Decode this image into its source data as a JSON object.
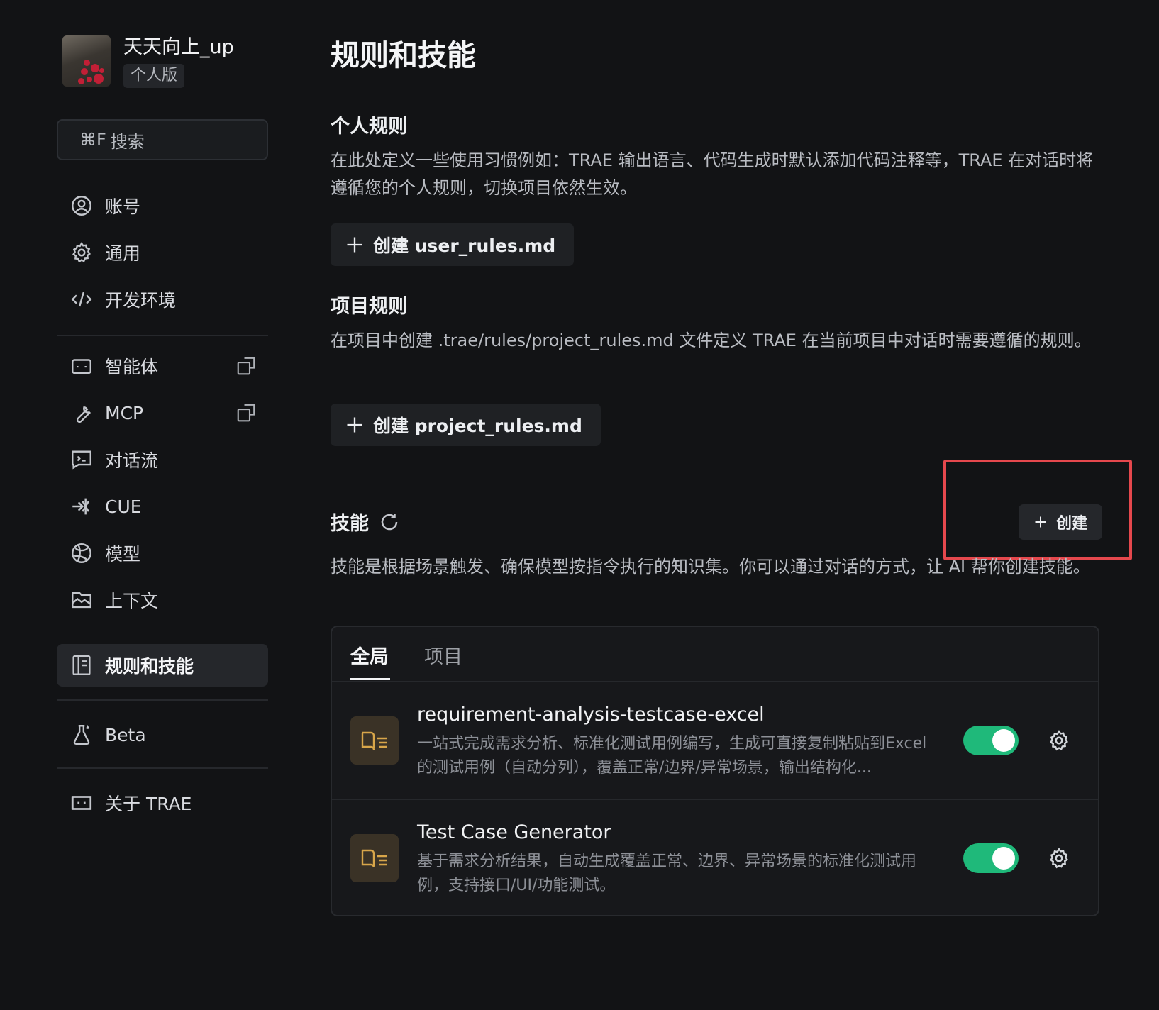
{
  "user": {
    "name": "天天向上_up",
    "plan": "个人版"
  },
  "search": {
    "shortcut": "⌘F",
    "label": "搜索"
  },
  "nav": {
    "account": "账号",
    "general": "通用",
    "dev_env": "开发环境",
    "agents": "智能体",
    "mcp": "MCP",
    "flow": "对话流",
    "cue": "CUE",
    "models": "模型",
    "context": "上下文",
    "rules_skills": "规则和技能",
    "beta": "Beta",
    "about": "关于 TRAE"
  },
  "page": {
    "title": "规则和技能"
  },
  "personal_rules": {
    "title": "个人规则",
    "desc": "在此处定义一些使用习惯例如：TRAE 输出语言、代码生成时默认添加代码注释等，TRAE 在对话时将遵循您的个人规则，切换项目依然生效。",
    "button": "创建 user_rules.md"
  },
  "project_rules": {
    "title": "项目规则",
    "desc": "在项目中创建 .trae/rules/project_rules.md 文件定义 TRAE 在当前项目中对话时需要遵循的规则。",
    "button": "创建 project_rules.md"
  },
  "skills": {
    "title": "技能",
    "create": "创建",
    "desc": "技能是根据场景触发、确保模型按指令执行的知识集。你可以通过对话的方式，让 AI 帮你创建技能。",
    "tabs": [
      "全局",
      "项目"
    ],
    "active_tab": "全局",
    "items": [
      {
        "name": "requirement-analysis-testcase-excel",
        "desc": "一站式完成需求分析、标准化测试用例编写，生成可直接复制粘贴到Excel的测试用例（自动分列），覆盖正常/边界/异常场景，输出结构化...",
        "enabled": true
      },
      {
        "name": "Test Case Generator",
        "desc": "基于需求分析结果，自动生成覆盖正常、边界、异常场景的标准化测试用例，支持接口/UI/功能测试。",
        "enabled": true
      }
    ]
  },
  "colors": {
    "accent_green": "#1fb97a",
    "highlight_red": "#e5484d",
    "book_icon": "#d8a64a"
  }
}
